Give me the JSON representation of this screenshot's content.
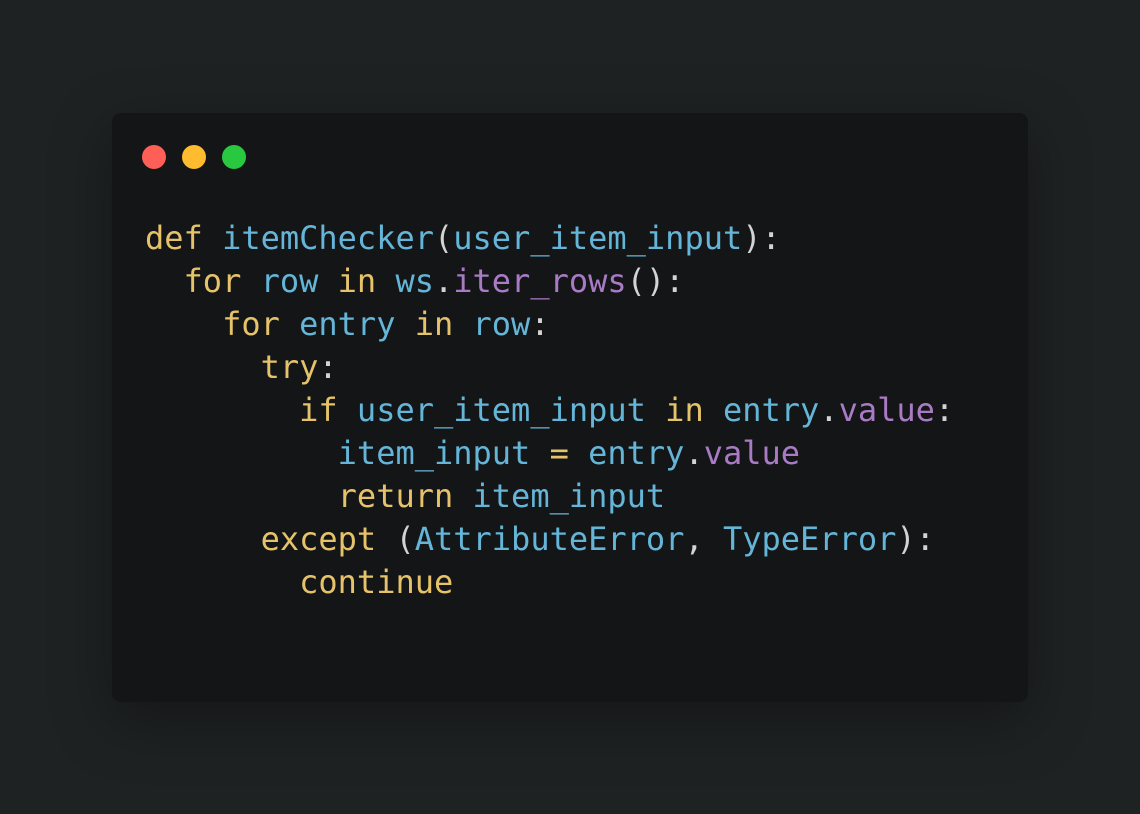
{
  "colors": {
    "background": "#1f2223",
    "window": "#131516",
    "dot_red": "#ff5f57",
    "dot_yellow": "#febc2e",
    "dot_green": "#28c840",
    "keyword": "#e6c36a",
    "name": "#65b5d8",
    "attribute": "#a97bc5",
    "punctuation": "#d3d3d3"
  },
  "window_controls": [
    {
      "name": "close-dot",
      "color": "#ff5f57"
    },
    {
      "name": "minimize-dot",
      "color": "#febc2e"
    },
    {
      "name": "maximize-dot",
      "color": "#28c840"
    }
  ],
  "code": {
    "language": "python",
    "lines": [
      [
        {
          "t": "def",
          "k": "keyword"
        },
        {
          "t": " ",
          "k": "punct"
        },
        {
          "t": "itemChecker",
          "k": "name"
        },
        {
          "t": "(",
          "k": "punct"
        },
        {
          "t": "user_item_input",
          "k": "name"
        },
        {
          "t": "):",
          "k": "punct"
        }
      ],
      [
        {
          "t": "  ",
          "k": "punct"
        },
        {
          "t": "for",
          "k": "keyword"
        },
        {
          "t": " ",
          "k": "punct"
        },
        {
          "t": "row",
          "k": "name"
        },
        {
          "t": " ",
          "k": "punct"
        },
        {
          "t": "in",
          "k": "keyword"
        },
        {
          "t": " ",
          "k": "punct"
        },
        {
          "t": "ws",
          "k": "name"
        },
        {
          "t": ".",
          "k": "punct"
        },
        {
          "t": "iter_rows",
          "k": "attr"
        },
        {
          "t": "():",
          "k": "punct"
        }
      ],
      [
        {
          "t": "    ",
          "k": "punct"
        },
        {
          "t": "for",
          "k": "keyword"
        },
        {
          "t": " ",
          "k": "punct"
        },
        {
          "t": "entry",
          "k": "name"
        },
        {
          "t": " ",
          "k": "punct"
        },
        {
          "t": "in",
          "k": "keyword"
        },
        {
          "t": " ",
          "k": "punct"
        },
        {
          "t": "row",
          "k": "name"
        },
        {
          "t": ":",
          "k": "punct"
        }
      ],
      [
        {
          "t": "      ",
          "k": "punct"
        },
        {
          "t": "try",
          "k": "keyword"
        },
        {
          "t": ":",
          "k": "punct"
        }
      ],
      [
        {
          "t": "        ",
          "k": "punct"
        },
        {
          "t": "if",
          "k": "keyword"
        },
        {
          "t": " ",
          "k": "punct"
        },
        {
          "t": "user_item_input",
          "k": "name"
        },
        {
          "t": " ",
          "k": "punct"
        },
        {
          "t": "in",
          "k": "keyword"
        },
        {
          "t": " ",
          "k": "punct"
        },
        {
          "t": "entry",
          "k": "name"
        },
        {
          "t": ".",
          "k": "punct"
        },
        {
          "t": "value",
          "k": "attr"
        },
        {
          "t": ":",
          "k": "punct"
        }
      ],
      [
        {
          "t": "          ",
          "k": "punct"
        },
        {
          "t": "item_input",
          "k": "name"
        },
        {
          "t": " ",
          "k": "punct"
        },
        {
          "t": "=",
          "k": "op"
        },
        {
          "t": " ",
          "k": "punct"
        },
        {
          "t": "entry",
          "k": "name"
        },
        {
          "t": ".",
          "k": "punct"
        },
        {
          "t": "value",
          "k": "attr"
        }
      ],
      [
        {
          "t": "          ",
          "k": "punct"
        },
        {
          "t": "return",
          "k": "keyword"
        },
        {
          "t": " ",
          "k": "punct"
        },
        {
          "t": "item_input",
          "k": "name"
        }
      ],
      [
        {
          "t": "      ",
          "k": "punct"
        },
        {
          "t": "except",
          "k": "keyword"
        },
        {
          "t": " (",
          "k": "punct"
        },
        {
          "t": "AttributeError",
          "k": "name"
        },
        {
          "t": ", ",
          "k": "punct"
        },
        {
          "t": "TypeError",
          "k": "name"
        },
        {
          "t": "):",
          "k": "punct"
        }
      ],
      [
        {
          "t": "        ",
          "k": "punct"
        },
        {
          "t": "continue",
          "k": "keyword"
        }
      ]
    ]
  }
}
